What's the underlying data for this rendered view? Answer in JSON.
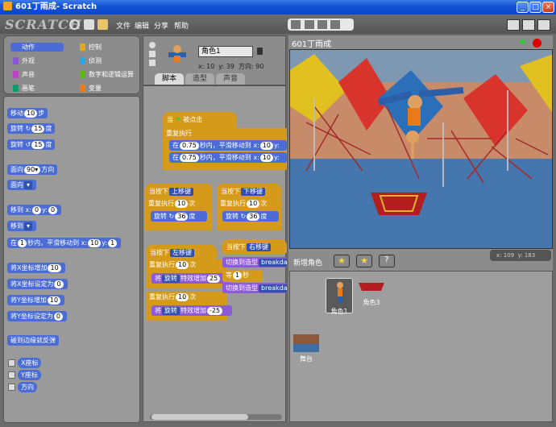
{
  "window": {
    "title": "601丁雨成- Scratch"
  },
  "menu": {
    "logo": "SCRATCH",
    "items": [
      "文件",
      "编辑",
      "分享",
      "帮助"
    ]
  },
  "categories": [
    {
      "label": "动作",
      "color": "#4a6cd4"
    },
    {
      "label": "控制",
      "color": "#e1a91a"
    },
    {
      "label": "外观",
      "color": "#8a55d7"
    },
    {
      "label": "侦测",
      "color": "#2ca5e2"
    },
    {
      "label": "声音",
      "color": "#bb42c3"
    },
    {
      "label": "数字和逻辑运算",
      "color": "#5cb712"
    },
    {
      "label": "画笔",
      "color": "#0e9a6c"
    },
    {
      "label": "变量",
      "color": "#ee7d16"
    }
  ],
  "palette": {
    "move": {
      "label": "移动",
      "value": "10",
      "suffix": "步"
    },
    "turn_cw": {
      "label": "旋转",
      "value": "15",
      "suffix": "度"
    },
    "turn_ccw": {
      "label": "旋转",
      "value": "15",
      "suffix": "度"
    },
    "point_dir": {
      "label": "面向",
      "value": "90▾",
      "suffix": "方向"
    },
    "point_to": {
      "label": "面向"
    },
    "goto_xy": {
      "label": "移到 x:",
      "x": "0",
      "ylabel": "y:",
      "y": "0"
    },
    "goto": {
      "label": "移到"
    },
    "glide": {
      "pre": "在",
      "secs": "1",
      "mid": "秒内，平滑移动到 x:",
      "x": "10",
      "ylabel": "y:",
      "y": "1"
    },
    "change_x": {
      "label": "将X坐标增加",
      "value": "10"
    },
    "set_x": {
      "label": "将X坐标设定为",
      "value": "0"
    },
    "change_y": {
      "label": "将Y坐标增加",
      "value": "10"
    },
    "set_y": {
      "label": "将Y坐标设定为",
      "value": "0"
    },
    "bounce": {
      "label": "碰到边缘就反弹"
    },
    "reporters": [
      "X座标",
      "Y座标",
      "方向"
    ]
  },
  "sprite": {
    "name": "角色1",
    "x_label": "x:",
    "x": "10",
    "y_label": "y:",
    "y": "39",
    "dir_label": "方向:",
    "dir": "90"
  },
  "tabs": [
    "脚本",
    "造型",
    "声音"
  ],
  "scripts": {
    "s1": {
      "hat": "当",
      "hat2": "被点击",
      "forever": "重复执行",
      "g1a": "在",
      "g1b": "0.75",
      "g1c": "秒内，平滑移动到 x:",
      "g1x": "10",
      "g1y": "y:"
    },
    "s2": {
      "hat": "当按下",
      "key": "上移键",
      "repeat": "重复执行",
      "times": "10",
      "ci": "次",
      "turn": "旋转",
      "deg": "36",
      "degs": "度"
    },
    "s3": {
      "hat": "当按下",
      "key": "下移键",
      "repeat": "重复执行",
      "times": "10",
      "ci": "次",
      "turn": "旋转",
      "deg": "36",
      "degs": "度"
    },
    "s4": {
      "hat": "当按下",
      "key": "左移键",
      "repeat": "重复执行",
      "times": "10",
      "ci": "次",
      "eff": "将",
      "effname": "旋转",
      "effchg": "特效增加",
      "val1": "25",
      "val2": "-25"
    },
    "s5": {
      "hat": "当按下",
      "key": "右移键",
      "switch": "切换到造型",
      "costume": "breakdan",
      "wait": "等",
      "waitv": "1",
      "waits": "秒"
    }
  },
  "stage": {
    "title": "601丁雨成"
  },
  "coords": {
    "x_label": "x:",
    "x": "109",
    "y_label": "y:",
    "y": "183"
  },
  "sprites": {
    "new_label": "新增角色",
    "items": [
      {
        "name": "角色1"
      },
      {
        "name": "角色3"
      }
    ],
    "stage_label": "舞台"
  }
}
